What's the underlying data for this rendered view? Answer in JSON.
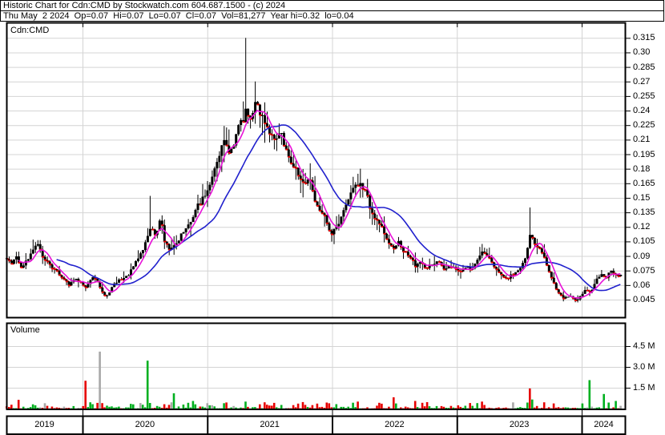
{
  "header": {
    "line1": "Historic Chart for Cdn:CMD by Stockwatch.com 604.687.1500 - (c) 2024",
    "line2": "Thu May  2 2024  Op=0.07  Hi=0.07  Lo=0.07  Cl=0.07  Vol=81,277  Year hi=0.32  lo=0.04"
  },
  "price_panel": {
    "label": "Cdn:CMD"
  },
  "volume_panel": {
    "label": "Volume"
  },
  "colors": {
    "candle": "#000000",
    "close_tick": "#ef0000",
    "ma_short": "#e812d8",
    "ma_long": "#2121cd",
    "vol_up": "#00b020",
    "vol_down": "#e60000",
    "vol_neutral": "#a8a8a8",
    "grid": "#d4d4d4",
    "frame": "#000000",
    "text": "#000000"
  },
  "chart_data": {
    "type": "candlestick",
    "symbol": "Cdn:CMD",
    "period": "weekly",
    "x_range_years": [
      2019.39,
      2024.31
    ],
    "price_axis": {
      "labels": [
        "0.315",
        "0.30",
        "0.285",
        "0.27",
        "0.255",
        "0.24",
        "0.225",
        "0.21",
        "0.195",
        "0.18",
        "0.165",
        "0.15",
        "0.135",
        "0.12",
        "0.105",
        "0.09",
        "0.075",
        "0.06",
        "0.045"
      ],
      "values": [
        0.315,
        0.3,
        0.285,
        0.27,
        0.255,
        0.24,
        0.225,
        0.21,
        0.195,
        0.18,
        0.165,
        0.15,
        0.135,
        0.12,
        0.105,
        0.09,
        0.075,
        0.06,
        0.045
      ]
    },
    "volume_axis": {
      "labels": [
        "4.5 M",
        "3.0 M",
        "1.5 M"
      ],
      "values_millions": [
        4.5,
        3.0,
        1.5
      ]
    },
    "years": [
      "2019",
      "2020",
      "2021",
      "2022",
      "2023",
      "2024"
    ],
    "close_anchors": [
      [
        2019.39,
        0.088
      ],
      [
        2019.429,
        0.082
      ],
      [
        2019.467,
        0.09
      ],
      [
        2019.506,
        0.078
      ],
      [
        2019.551,
        0.085
      ],
      [
        2019.595,
        0.098
      ],
      [
        2019.634,
        0.102
      ],
      [
        2019.673,
        0.09
      ],
      [
        2019.711,
        0.085
      ],
      [
        2019.756,
        0.078
      ],
      [
        2019.801,
        0.072
      ],
      [
        2019.852,
        0.065
      ],
      [
        2019.891,
        0.06
      ],
      [
        2019.936,
        0.066
      ],
      [
        2019.981,
        0.062
      ],
      [
        2020.026,
        0.058
      ],
      [
        2020.071,
        0.068
      ],
      [
        2020.116,
        0.063
      ],
      [
        2020.154,
        0.052
      ],
      [
        2020.193,
        0.048
      ],
      [
        2020.238,
        0.06
      ],
      [
        2020.282,
        0.064
      ],
      [
        2020.327,
        0.068
      ],
      [
        2020.372,
        0.072
      ],
      [
        2020.417,
        0.082
      ],
      [
        2020.462,
        0.092
      ],
      [
        2020.507,
        0.105
      ],
      [
        2020.546,
        0.122
      ],
      [
        2020.584,
        0.108
      ],
      [
        2020.623,
        0.128
      ],
      [
        2020.661,
        0.102
      ],
      [
        2020.7,
        0.096
      ],
      [
        2020.745,
        0.104
      ],
      [
        2020.79,
        0.112
      ],
      [
        2020.835,
        0.118
      ],
      [
        2020.88,
        0.128
      ],
      [
        2020.925,
        0.142
      ],
      [
        2020.969,
        0.152
      ],
      [
        2021.008,
        0.163
      ],
      [
        2021.053,
        0.178
      ],
      [
        2021.098,
        0.198
      ],
      [
        2021.143,
        0.208
      ],
      [
        2021.188,
        0.196
      ],
      [
        2021.233,
        0.218
      ],
      [
        2021.271,
        0.228
      ],
      [
        2021.303,
        0.238
      ],
      [
        2021.335,
        0.225
      ],
      [
        2021.374,
        0.248
      ],
      [
        2021.412,
        0.242
      ],
      [
        2021.451,
        0.23
      ],
      [
        2021.496,
        0.213
      ],
      [
        2021.541,
        0.208
      ],
      [
        2021.586,
        0.22
      ],
      [
        2021.631,
        0.196
      ],
      [
        2021.676,
        0.186
      ],
      [
        2021.721,
        0.176
      ],
      [
        2021.766,
        0.162
      ],
      [
        2021.811,
        0.172
      ],
      [
        2021.856,
        0.15
      ],
      [
        2021.9,
        0.138
      ],
      [
        2021.945,
        0.127
      ],
      [
        2021.99,
        0.112
      ],
      [
        2022.035,
        0.12
      ],
      [
        2022.08,
        0.133
      ],
      [
        2022.125,
        0.148
      ],
      [
        2022.17,
        0.158
      ],
      [
        2022.215,
        0.166
      ],
      [
        2022.26,
        0.158
      ],
      [
        2022.305,
        0.138
      ],
      [
        2022.35,
        0.127
      ],
      [
        2022.395,
        0.118
      ],
      [
        2022.44,
        0.108
      ],
      [
        2022.485,
        0.098
      ],
      [
        2022.53,
        0.106
      ],
      [
        2022.575,
        0.094
      ],
      [
        2022.619,
        0.089
      ],
      [
        2022.664,
        0.08
      ],
      [
        2022.709,
        0.086
      ],
      [
        2022.754,
        0.076
      ],
      [
        2022.799,
        0.081
      ],
      [
        2022.844,
        0.086
      ],
      [
        2022.889,
        0.076
      ],
      [
        2022.934,
        0.081
      ],
      [
        2022.979,
        0.078
      ],
      [
        2023.024,
        0.072
      ],
      [
        2023.069,
        0.08
      ],
      [
        2023.114,
        0.076
      ],
      [
        2023.159,
        0.085
      ],
      [
        2023.204,
        0.094
      ],
      [
        2023.249,
        0.088
      ],
      [
        2023.294,
        0.079
      ],
      [
        2023.339,
        0.071
      ],
      [
        2023.384,
        0.065
      ],
      [
        2023.429,
        0.07
      ],
      [
        2023.473,
        0.075
      ],
      [
        2023.518,
        0.081
      ],
      [
        2023.557,
        0.092
      ],
      [
        2023.589,
        0.115
      ],
      [
        2023.621,
        0.104
      ],
      [
        2023.653,
        0.099
      ],
      [
        2023.692,
        0.091
      ],
      [
        2023.73,
        0.076
      ],
      [
        2023.769,
        0.062
      ],
      [
        2023.814,
        0.052
      ],
      [
        2023.859,
        0.046
      ],
      [
        2023.904,
        0.05
      ],
      [
        2023.949,
        0.044
      ],
      [
        2023.994,
        0.05
      ],
      [
        2024.032,
        0.056
      ],
      [
        2024.071,
        0.052
      ],
      [
        2024.109,
        0.065
      ],
      [
        2024.148,
        0.071
      ],
      [
        2024.186,
        0.068
      ],
      [
        2024.225,
        0.074
      ],
      [
        2024.263,
        0.071
      ],
      [
        2024.302,
        0.07
      ]
    ],
    "wick_spikes": [
      {
        "t": 2019.595,
        "high": 0.107
      },
      {
        "t": 2020.546,
        "high": 0.152
      },
      {
        "t": 2021.303,
        "high": 0.315
      },
      {
        "t": 2021.374,
        "high": 0.27
      },
      {
        "t": 2022.215,
        "high": 0.18
      },
      {
        "t": 2023.589,
        "high": 0.14
      }
    ],
    "volume_spikes": [
      {
        "t": 2020.026,
        "millions": 2.0,
        "color": "vol_down"
      },
      {
        "t": 2020.141,
        "millions": 4.1,
        "color": "vol_neutral"
      },
      {
        "t": 2020.527,
        "millions": 3.45,
        "color": "vol_up"
      },
      {
        "t": 2020.738,
        "millions": 1.1,
        "color": "vol_up"
      },
      {
        "t": 2020.88,
        "millions": 0.55,
        "color": "vol_up"
      },
      {
        "t": 2021.31,
        "millions": 0.5,
        "color": "vol_up"
      },
      {
        "t": 2021.457,
        "millions": 0.45,
        "color": "vol_down"
      },
      {
        "t": 2022.196,
        "millions": 0.5,
        "color": "vol_down"
      },
      {
        "t": 2023.197,
        "millions": 0.5,
        "color": "vol_down"
      },
      {
        "t": 2023.582,
        "millions": 1.45,
        "color": "vol_down"
      },
      {
        "t": 2023.608,
        "millions": 0.65,
        "color": "vol_up"
      },
      {
        "t": 2024.064,
        "millions": 2.05,
        "color": "vol_up"
      },
      {
        "t": 2024.173,
        "millions": 1.05,
        "color": "vol_up"
      },
      {
        "t": 2024.263,
        "millions": 0.55,
        "color": "vol_up"
      }
    ],
    "moving_averages": {
      "short_window_weeks": 6,
      "long_window_weeks": 22
    }
  }
}
